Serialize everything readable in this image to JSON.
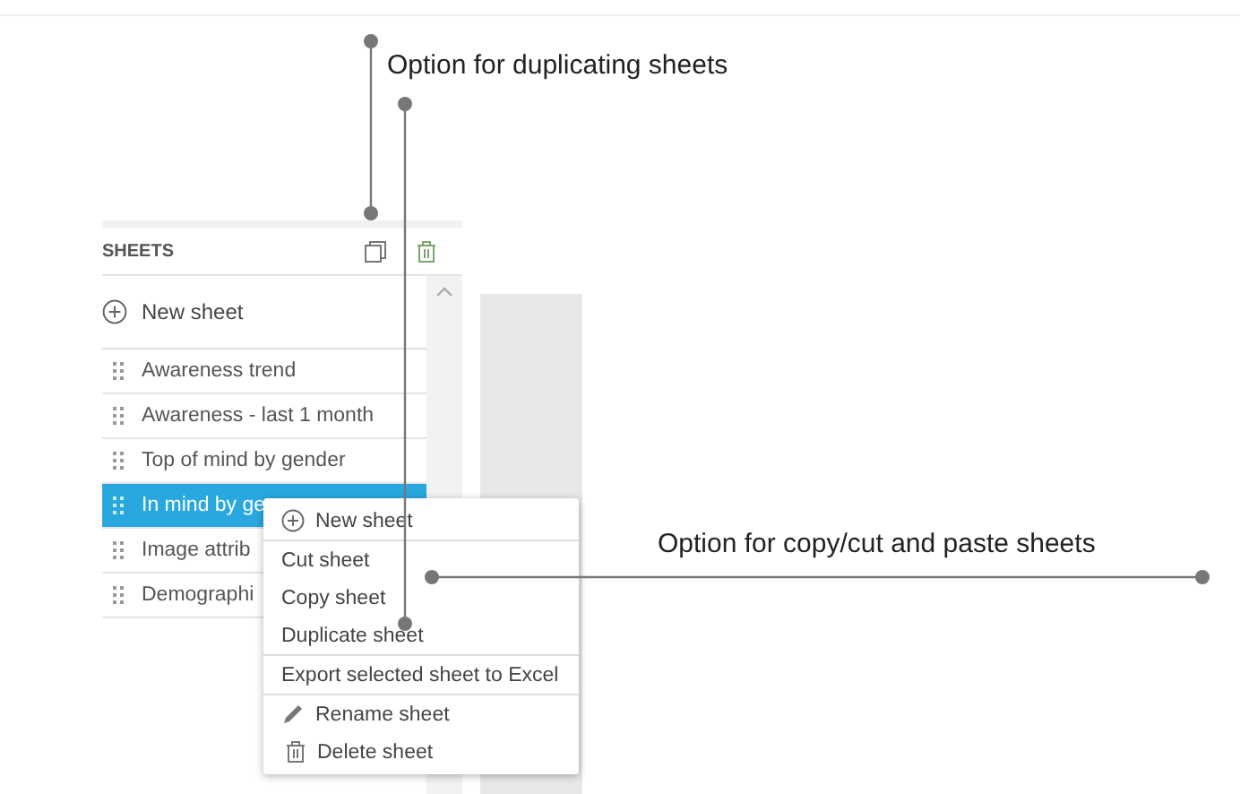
{
  "annotations": [
    {
      "text": "Option for duplicating sheets"
    },
    {
      "text": "Option for copy/cut and paste sheets"
    }
  ],
  "sidebar": {
    "title": "SHEETS",
    "new_sheet": "New sheet",
    "sheets": [
      {
        "label": "Awareness trend",
        "selected": false
      },
      {
        "label": "Awareness - last 1 month",
        "selected": false
      },
      {
        "label": "Top of mind by gender",
        "selected": false
      },
      {
        "label": "In mind by ge",
        "selected": true
      },
      {
        "label": "Image attrib",
        "selected": false
      },
      {
        "label": "Demographi",
        "selected": false
      }
    ]
  },
  "context_menu": {
    "sections": [
      [
        {
          "label": "New sheet",
          "kind": "plus"
        }
      ],
      [
        {
          "label": "Cut sheet",
          "kind": "plain"
        },
        {
          "label": "Copy sheet",
          "kind": "plain"
        },
        {
          "label": "Duplicate sheet",
          "kind": "plain"
        }
      ],
      [
        {
          "label": "Export selected sheet to Excel",
          "kind": "plain"
        }
      ],
      [
        {
          "label": "Rename sheet",
          "kind": "pencil"
        },
        {
          "label": "Delete sheet",
          "kind": "trash"
        }
      ]
    ]
  }
}
